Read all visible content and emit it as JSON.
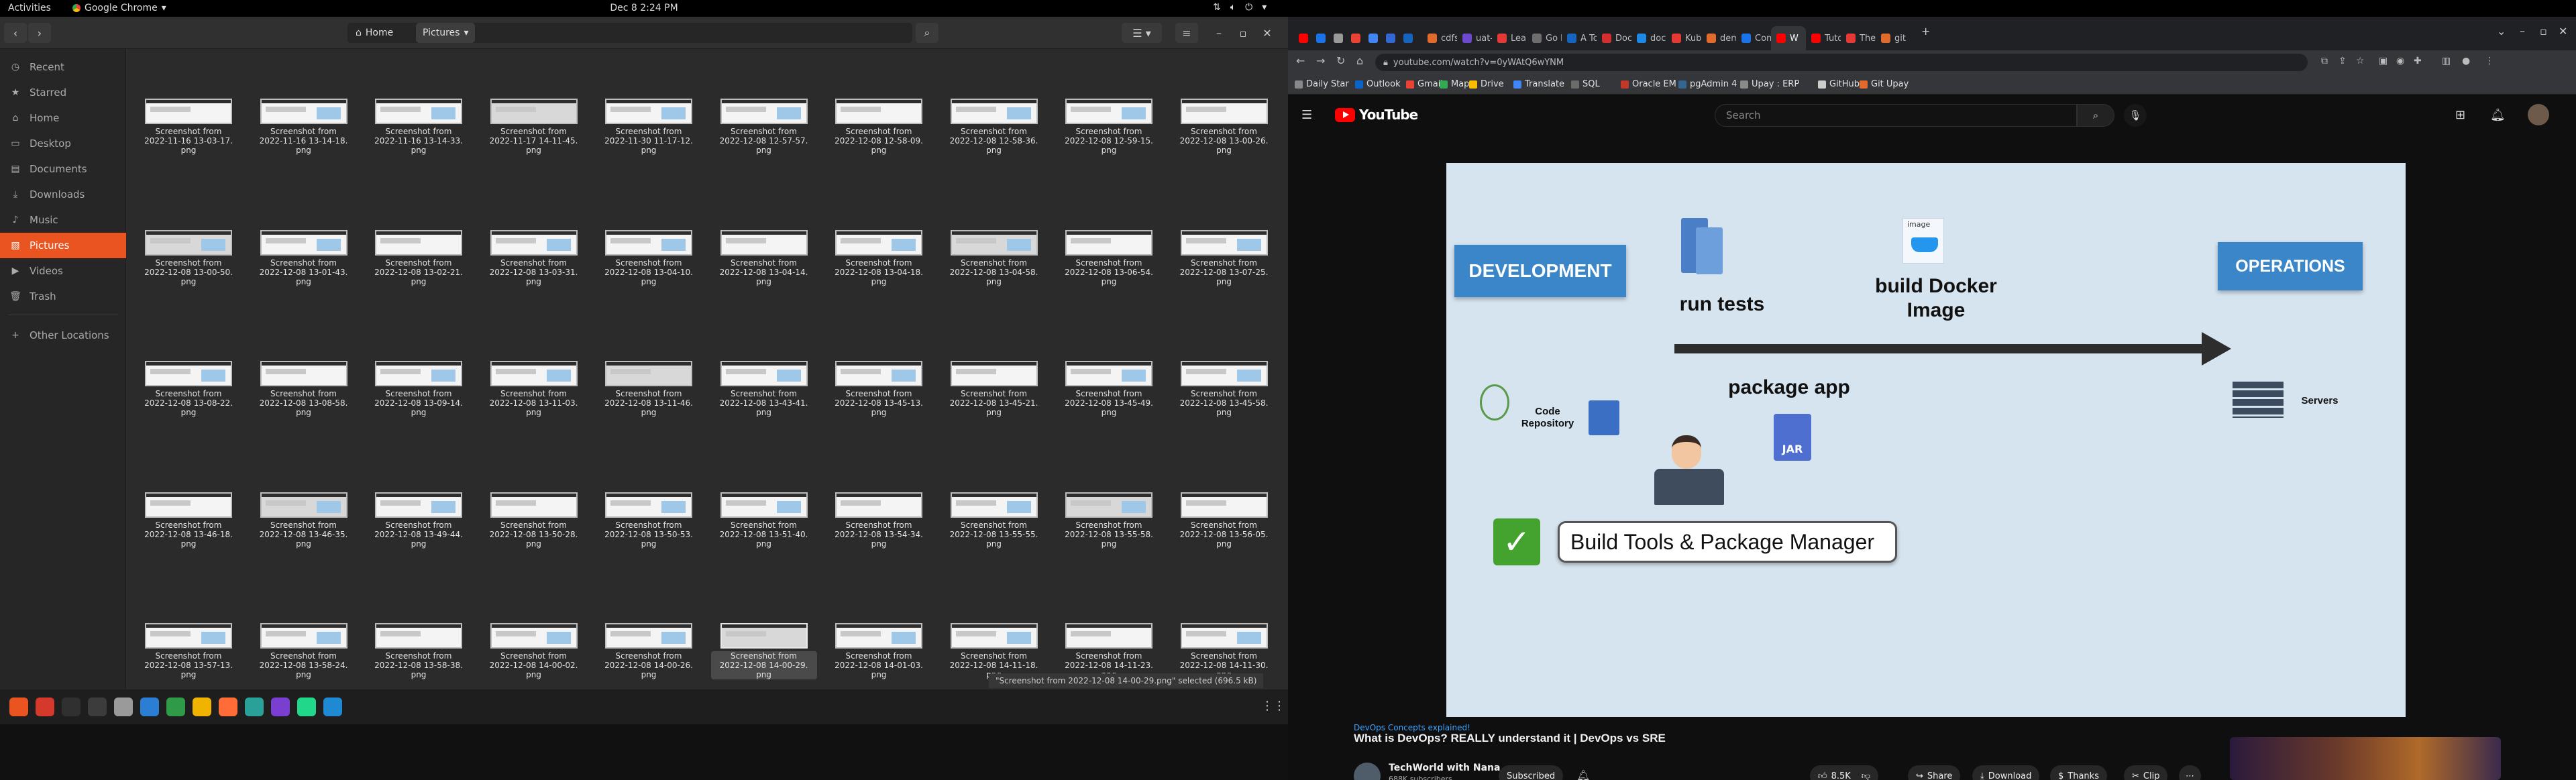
{
  "topbar": {
    "activities": "Activities",
    "app_name": "Google Chrome",
    "clock": "Dec 8  2:24 PM"
  },
  "files": {
    "path": {
      "home": "Home",
      "current": "Pictures"
    },
    "sidebar": [
      {
        "label": "Recent",
        "icon": "clock-icon"
      },
      {
        "label": "Starred",
        "icon": "star-icon"
      },
      {
        "label": "Home",
        "icon": "home-icon"
      },
      {
        "label": "Desktop",
        "icon": "folder-icon"
      },
      {
        "label": "Documents",
        "icon": "document-icon"
      },
      {
        "label": "Downloads",
        "icon": "download-icon"
      },
      {
        "label": "Music",
        "icon": "music-icon"
      },
      {
        "label": "Pictures",
        "icon": "image-icon",
        "active": true
      },
      {
        "label": "Videos",
        "icon": "video-icon"
      },
      {
        "label": "Trash",
        "icon": "trash-icon"
      },
      {
        "label": "Other Locations",
        "icon": "plus-icon"
      }
    ],
    "file_prefix": "Screenshot from",
    "file_suffix": "png",
    "files": [
      "2022-11-16 13-03-17.",
      "2022-11-16 13-14-18.",
      "2022-11-16 13-14-33.",
      "2022-11-17 14-11-45.",
      "2022-11-30 11-17-12.",
      "2022-12-08 12-57-57.",
      "2022-12-08 12-58-09.",
      "2022-12-08 12-58-36.",
      "2022-12-08 12-59-15.",
      "2022-12-08 13-00-26.",
      "2022-12-08 13-00-50.",
      "2022-12-08 13-01-43.",
      "2022-12-08 13-02-21.",
      "2022-12-08 13-03-31.",
      "2022-12-08 13-04-10.",
      "2022-12-08 13-04-14.",
      "2022-12-08 13-04-18.",
      "2022-12-08 13-04-58.",
      "2022-12-08 13-06-54.",
      "2022-12-08 13-07-25.",
      "2022-12-08 13-08-22.",
      "2022-12-08 13-08-58.",
      "2022-12-08 13-09-14.",
      "2022-12-08 13-11-03.",
      "2022-12-08 13-11-46.",
      "2022-12-08 13-43-41.",
      "2022-12-08 13-45-13.",
      "2022-12-08 13-45-21.",
      "2022-12-08 13-45-49.",
      "2022-12-08 13-45-58.",
      "2022-12-08 13-46-18.",
      "2022-12-08 13-46-35.",
      "2022-12-08 13-49-44.",
      "2022-12-08 13-50-28.",
      "2022-12-08 13-50-53.",
      "2022-12-08 13-51-40.",
      "2022-12-08 13-54-34.",
      "2022-12-08 13-55-55.",
      "2022-12-08 13-55-58.",
      "2022-12-08 13-56-05.",
      "2022-12-08 13-57-13.",
      "2022-12-08 13-58-24.",
      "2022-12-08 13-58-38.",
      "2022-12-08 14-00-02.",
      "2022-12-08 14-00-26.",
      "2022-12-08 14-00-29.",
      "2022-12-08 14-01-03.",
      "2022-12-08 14-11-18.",
      "2022-12-08 14-11-23.",
      "2022-12-08 14-11-30."
    ],
    "selected_index": 45,
    "status": "\"Screenshot from 2022-12-08 14-00-29.png\" selected (696.5 kB)"
  },
  "dock": {
    "apps": [
      {
        "icon": "ubuntu-software-icon",
        "color": "#e95420"
      },
      {
        "icon": "anydesk-icon",
        "color": "#d5392c"
      },
      {
        "icon": "obs-icon",
        "color": "#303030"
      },
      {
        "icon": "terminal-icon",
        "color": "#3c3c3c"
      },
      {
        "icon": "files-icon",
        "color": "#9a9a9a"
      },
      {
        "icon": "libreoffice-writer-icon",
        "color": "#2a7fd4"
      },
      {
        "icon": "libreoffice-calc-icon",
        "color": "#2f9a48"
      },
      {
        "icon": "chrome-icon",
        "color": "#f0b400"
      },
      {
        "icon": "postman-icon",
        "color": "#ff6c37"
      },
      {
        "icon": "screenshot-tool-icon",
        "color": "#2aa198"
      },
      {
        "icon": "jetbrains-icon",
        "color": "#7a3fd0"
      },
      {
        "icon": "pycharm-icon",
        "color": "#21d789"
      },
      {
        "icon": "vscode-icon",
        "color": "#1f8ad2"
      }
    ]
  },
  "chrome": {
    "tabs": [
      {
        "label": "",
        "color": "#ff0000"
      },
      {
        "label": "",
        "color": "#1a73e8"
      },
      {
        "label": "",
        "color": "#999999"
      },
      {
        "label": "",
        "color": "#ea4335"
      },
      {
        "label": "",
        "color": "#4285f4"
      },
      {
        "label": "",
        "color": "#3367d6"
      },
      {
        "label": "",
        "color": "#1565c0"
      },
      {
        "label": "cdfs",
        "color": "#e06b2c"
      },
      {
        "label": "uat-",
        "color": "#6c4ad0"
      },
      {
        "label": "Lear",
        "color": "#e53935"
      },
      {
        "label": "Go b",
        "color": "#6d6d6d"
      },
      {
        "label": "A To",
        "color": "#1565c0"
      },
      {
        "label": "Doc",
        "color": "#d32f2f"
      },
      {
        "label": "dock",
        "color": "#1e88e5"
      },
      {
        "label": "Kub",
        "color": "#e53935"
      },
      {
        "label": "dem",
        "color": "#e06b2c"
      },
      {
        "label": "Con",
        "color": "#1a73e8"
      },
      {
        "label": "W",
        "color": "#ff0000",
        "active": true
      },
      {
        "label": "Tuto",
        "color": "#ff0000"
      },
      {
        "label": "The",
        "color": "#e53935"
      },
      {
        "label": "git",
        "color": "#e06b2c"
      }
    ],
    "new_tab": "+",
    "url": "youtube.com/watch?v=0yWAtQ6wYNM",
    "bookmarks": [
      {
        "label": "Daily Star",
        "color": "#888888"
      },
      {
        "label": "Outlook",
        "color": "#0a64c8"
      },
      {
        "label": "Gmail",
        "color": "#ea4335"
      },
      {
        "label": "Maps",
        "color": "#34a853"
      },
      {
        "label": "Drive",
        "color": "#fbbc04"
      },
      {
        "label": "Translate",
        "color": "#4285f4"
      },
      {
        "label": "SQL",
        "color": "#6b6b6b"
      },
      {
        "label": "Oracle EM",
        "color": "#c0392b"
      },
      {
        "label": "pgAdmin 4",
        "color": "#336791"
      },
      {
        "label": "Upay : ERP",
        "color": "#8a8a8a"
      },
      {
        "label": "GitHub",
        "color": "#cccccc"
      },
      {
        "label": "Git Upay",
        "color": "#e06b2c"
      }
    ]
  },
  "youtube": {
    "logo": "YouTube",
    "search_placeholder": "Search",
    "video": {
      "development": "DEVELOPMENT",
      "operations": "OPERATIONS",
      "run_tests": "run tests",
      "build_docker": "build Docker",
      "build_docker_2": "Image",
      "image_tag": "image",
      "package_app": "package app",
      "code_repo": "Code",
      "code_repo_2": "Repository",
      "servers": "Servers",
      "jar": "JAR",
      "build_tools": "Build Tools & Package Manager"
    },
    "hashtag": "DevOps Concepts explained!",
    "title": "What is DevOps? REALLY understand it | DevOps vs SRE",
    "channel": "TechWorld with Nana",
    "subscribers": "688K subscribers",
    "subscribed": "Subscribed",
    "likes": "8.5K",
    "share": "Share",
    "download": "Download",
    "thanks": "Thanks",
    "clip": "Clip"
  }
}
